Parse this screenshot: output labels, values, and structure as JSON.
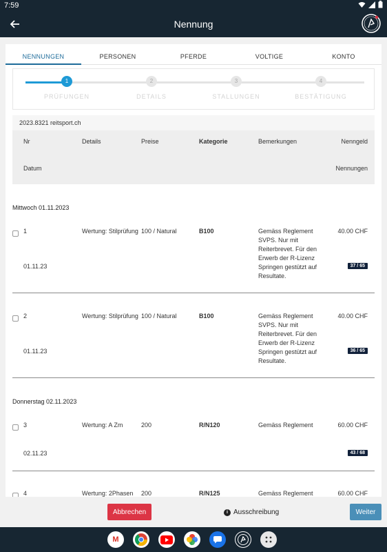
{
  "status": {
    "time": "7:59"
  },
  "appbar": {
    "title": "Nennung"
  },
  "tabs": [
    {
      "label": "NENNUNGEN"
    },
    {
      "label": "PERSONEN"
    },
    {
      "label": "PFERDE"
    },
    {
      "label": "VOLTIGE"
    },
    {
      "label": "KONTO"
    }
  ],
  "steps": [
    {
      "num": "1",
      "label": "PRÜFUNGEN"
    },
    {
      "num": "2",
      "label": "DETAILS"
    },
    {
      "num": "3",
      "label": "STALLUNGEN"
    },
    {
      "num": "4",
      "label": "BESTÄTIGUNG"
    }
  ],
  "table": {
    "organizer": "2023.8321 reitsport.ch",
    "headers": {
      "nr": "Nr",
      "details": "Details",
      "preise": "Preise",
      "kategorie": "Kategorie",
      "bemerkungen": "Bemerkungen",
      "nenngeld": "Nenngeld",
      "datum": "Datum",
      "nennungen": "Nennungen"
    }
  },
  "days": [
    {
      "label": "Mittwoch 01.11.2023"
    },
    {
      "label": "Donnerstag 02.11.2023"
    }
  ],
  "rows": [
    {
      "nr": "1",
      "details": "Wertung: Stilprüfung",
      "preise": "100 / Natural",
      "kategorie": "B100",
      "bemerkungen": "Gemäss Reglement SVPS. Nur mit Reiterbrevet. Für den Erwerb der R-Lizenz Springen gestützt auf Resultate.",
      "nenngeld": "40.00 CHF",
      "datum": "01.11.23",
      "nennungen": "37 / 65"
    },
    {
      "nr": "2",
      "details": "Wertung: Stilprüfung",
      "preise": "100 / Natural",
      "kategorie": "B100",
      "bemerkungen": "Gemäss Reglement SVPS. Nur mit Reiterbrevet. Für den Erwerb der R-Lizenz Springen gestützt auf Resultate.",
      "nenngeld": "40.00 CHF",
      "datum": "01.11.23",
      "nennungen": "36 / 65"
    },
    {
      "nr": "3",
      "details": "Wertung: A Zm",
      "preise": "200",
      "kategorie": "R/N120",
      "bemerkungen": "Gemäss Reglement",
      "nenngeld": "60.00 CHF",
      "datum": "02.11.23",
      "nennungen": "43 / 68"
    },
    {
      "nr": "4",
      "details": "Wertung: 2Phasen",
      "preise": "200",
      "kategorie": "R/N125",
      "bemerkungen": "Gemäss Reglement",
      "nenngeld": "60.00 CHF",
      "datum": "",
      "nennungen": ""
    }
  ],
  "footer": {
    "cancel": "Abbrechen",
    "info": "Ausschreibung",
    "next": "Weiter"
  },
  "dock": [
    {
      "icon": "gmail-icon",
      "glyph": "M"
    },
    {
      "icon": "chrome-icon",
      "glyph": ""
    },
    {
      "icon": "youtube-icon",
      "glyph": "▶"
    },
    {
      "icon": "photos-icon",
      "glyph": "✿"
    },
    {
      "icon": "messages-icon",
      "glyph": "☰"
    },
    {
      "icon": "app-logo-icon",
      "glyph": ""
    },
    {
      "icon": "app-drawer-icon",
      "glyph": "⋮⋮"
    }
  ],
  "colors": {
    "appbar": "#172632",
    "accent": "#1e9ad6",
    "danger": "#dc3545",
    "primary_btn": "#4a8fb8",
    "badge": "#11213a"
  }
}
